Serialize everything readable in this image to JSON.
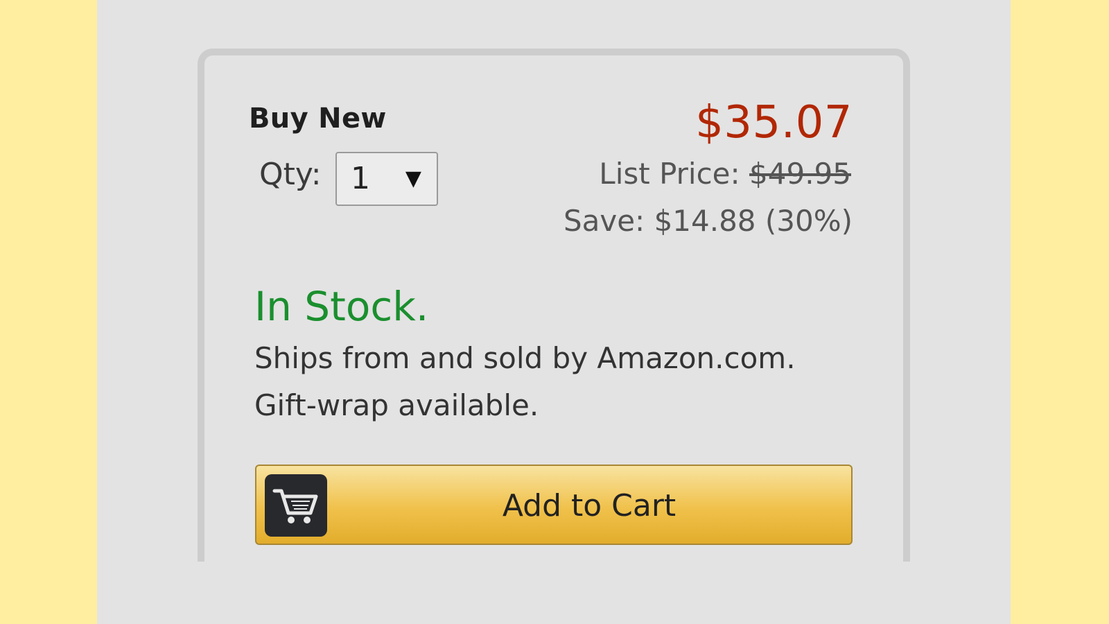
{
  "buy_box": {
    "heading": "Buy New",
    "qty": {
      "label": "Qty:",
      "selected": "1",
      "arrow": "▼"
    },
    "price": "$35.07",
    "list_price": {
      "label": "List Price: ",
      "value": "$49.95"
    },
    "savings": "Save: $14.88 (30%)",
    "stock_status": "In Stock.",
    "ships_from": "Ships from and sold by Amazon.com.",
    "gift_wrap": "Gift-wrap available.",
    "add_to_cart": {
      "label": "Add to Cart",
      "icon": "shopping-cart-icon"
    }
  },
  "colors": {
    "price": "#b12704",
    "in_stock": "#1a8f2e",
    "button": "#f0c14b",
    "page_backdrop": "#ffeea0"
  }
}
